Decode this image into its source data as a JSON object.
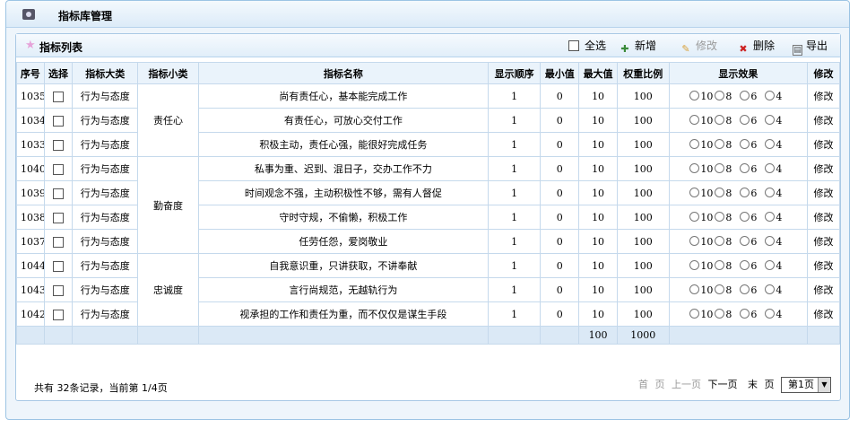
{
  "window": {
    "title": "指标库管理",
    "icon": "camera-icon"
  },
  "panel": {
    "title": "指标列表",
    "toolbar": {
      "select_all": "全选",
      "add": "新增",
      "edit": "修改",
      "delete": "删除",
      "export": "导出"
    }
  },
  "table": {
    "headers": [
      "序号",
      "选择",
      "指标大类",
      "指标小类",
      "指标名称",
      "显示顺序",
      "最小值",
      "最大值",
      "权重比例",
      "显示效果",
      "修改"
    ],
    "groups": [
      "责任心",
      "勤奋度",
      "忠诚度"
    ],
    "radio_options": [
      "10",
      "8",
      "6",
      "4"
    ],
    "rows": [
      {
        "id": "1035",
        "category": "行为与态度",
        "name": "尚有责任心，基本能完成工作",
        "order": "1",
        "min": "0",
        "max": "10",
        "weight": "100",
        "edit": "修改"
      },
      {
        "id": "1034",
        "category": "行为与态度",
        "name": "有责任心，可放心交付工作",
        "order": "1",
        "min": "0",
        "max": "10",
        "weight": "100",
        "edit": "修改"
      },
      {
        "id": "1033",
        "category": "行为与态度",
        "name": "积极主动，责任心强，能很好完成任务",
        "order": "1",
        "min": "0",
        "max": "10",
        "weight": "100",
        "edit": "修改"
      },
      {
        "id": "1040",
        "category": "行为与态度",
        "name": "私事为重、迟到、混日子，交办工作不力",
        "order": "1",
        "min": "0",
        "max": "10",
        "weight": "100",
        "edit": "修改"
      },
      {
        "id": "1039",
        "category": "行为与态度",
        "name": "时间观念不强，主动积极性不够，需有人督促",
        "order": "1",
        "min": "0",
        "max": "10",
        "weight": "100",
        "edit": "修改"
      },
      {
        "id": "1038",
        "category": "行为与态度",
        "name": "守时守规，不偷懒，积极工作",
        "order": "1",
        "min": "0",
        "max": "10",
        "weight": "100",
        "edit": "修改"
      },
      {
        "id": "1037",
        "category": "行为与态度",
        "name": "任劳任怨，爱岗敬业",
        "order": "1",
        "min": "0",
        "max": "10",
        "weight": "100",
        "edit": "修改"
      },
      {
        "id": "1044",
        "category": "行为与态度",
        "name": "自我意识重，只讲获取，不讲奉献",
        "order": "1",
        "min": "0",
        "max": "10",
        "weight": "100",
        "edit": "修改"
      },
      {
        "id": "1043",
        "category": "行为与态度",
        "name": "言行尚规范，无越轨行为",
        "order": "1",
        "min": "0",
        "max": "10",
        "weight": "100",
        "edit": "修改"
      },
      {
        "id": "1042",
        "category": "行为与态度",
        "name": "视承担的工作和责任为重，而不仅仅是谋生手段",
        "order": "1",
        "min": "0",
        "max": "10",
        "weight": "100",
        "edit": "修改"
      }
    ],
    "totals": {
      "max": "100",
      "weight": "1000"
    }
  },
  "footer": {
    "info": "共有 32条记录，当前第 1/4页",
    "pager": {
      "first": "首",
      "prev_page": "页",
      "prev": "上一页",
      "next": "下一页",
      "last": "末",
      "last_page": "页",
      "select_value": "第1页"
    }
  }
}
